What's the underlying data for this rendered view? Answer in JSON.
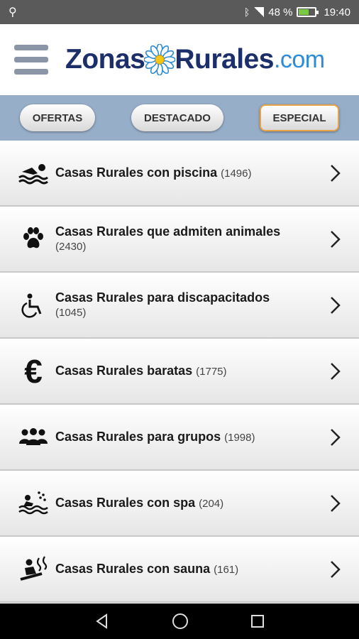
{
  "status": {
    "battery_text": "48 %",
    "time": "19:40",
    "icons": [
      "usb-icon",
      "bluetooth-icon",
      "signal-icon",
      "battery-icon"
    ]
  },
  "header": {
    "logo_part1": "Zonas",
    "logo_part2": "Rurales",
    "logo_part3": ".com"
  },
  "filters": [
    {
      "label": "OFERTAS"
    },
    {
      "label": "DESTACADO"
    },
    {
      "label": "ESPECIAL"
    }
  ],
  "items": [
    {
      "label": "Casas Rurales con piscina",
      "count": "(1496)",
      "icon": "swimming-icon"
    },
    {
      "label": "Casas Rurales que admiten animales",
      "count": "(2430)",
      "icon": "paw-icon"
    },
    {
      "label": "Casas Rurales para discapacitados",
      "count": "(1045)",
      "icon": "wheelchair-icon"
    },
    {
      "label": "Casas Rurales baratas",
      "count": "(1775)",
      "icon": "euro-icon"
    },
    {
      "label": "Casas Rurales para grupos",
      "count": "(1998)",
      "icon": "group-icon"
    },
    {
      "label": "Casas Rurales con spa",
      "count": "(204)",
      "icon": "spa-icon"
    },
    {
      "label": "Casas Rurales con sauna",
      "count": "(161)",
      "icon": "sauna-icon"
    }
  ],
  "colors": {
    "brand_dark": "#1d2f6a",
    "brand_light": "#2e8bd6",
    "filter_bar": "#97aec8",
    "active_border": "#e8a24a"
  }
}
